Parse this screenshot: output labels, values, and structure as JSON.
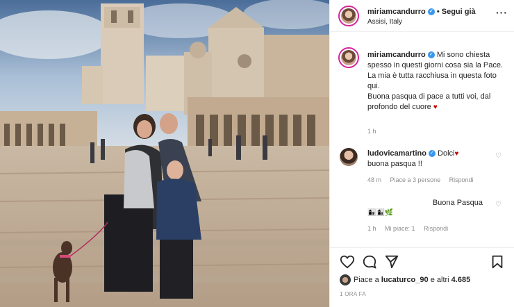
{
  "header": {
    "username": "miriamcandurro",
    "separator": "•",
    "follow_label": "Segui già",
    "location": "Assisi, Italy",
    "more_label": "···"
  },
  "caption": {
    "username": "miriamcandurro",
    "text": "Mi sono chiesta spesso in questi giorni cosa sia la Pace.\nLa mia è tutta racchiusa in questa foto qui.\nBuona pasqua di pace a tutti voi, dal profondo del cuore",
    "heart": "♥",
    "time": "1 h"
  },
  "comments": [
    {
      "username": "ludovicamartino",
      "text": "Dolci",
      "text2": "buona pasqua !!",
      "time": "48 m",
      "likes": "Piace a 3 persone",
      "reply": "Rispondi"
    },
    {
      "emojis": "👩‍👧👩‍👦🌿",
      "text": "Buona Pasqua",
      "time": "1 h",
      "likes": "Mi piace: 1",
      "reply": "Rispondi"
    }
  ],
  "actions": {
    "likes_text": "Piace a",
    "likes_user": "lucaturco_90",
    "likes_rest": "e altri",
    "likes_count": "4.685",
    "posted": "1 ORA FA"
  },
  "colors": {
    "verified": "#3897f0",
    "heart": "#cc0000",
    "muted": "#8e8e8e"
  }
}
